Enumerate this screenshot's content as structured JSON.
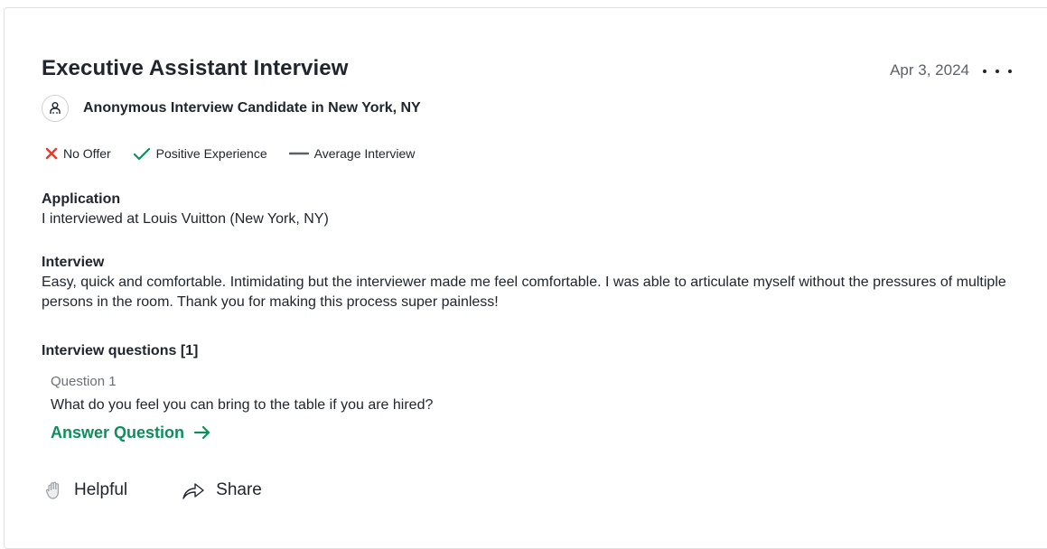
{
  "review": {
    "title": "Executive Assistant Interview",
    "date": "Apr 3, 2024",
    "author": "Anonymous Interview Candidate in New York, NY",
    "badges": [
      {
        "label": "No Offer",
        "icon": "x-icon",
        "color": "#e53e2e"
      },
      {
        "label": "Positive Experience",
        "icon": "checkmark-icon",
        "color": "#0c8f5a"
      },
      {
        "label": "Average Interview",
        "icon": "dash-icon",
        "color": "#5c6168"
      }
    ],
    "application": {
      "label": "Application",
      "text": "I interviewed at Louis Vuitton (New York, NY)"
    },
    "interview": {
      "label": "Interview",
      "text": "Easy, quick and comfortable. Intimidating but the interviewer made me feel comfortable. I was able to articulate myself without the pressures of multiple persons in the room. Thank you for making this process super painless!"
    },
    "questions": {
      "label": "Interview questions [1]",
      "items": [
        {
          "number": "Question 1",
          "text": "What do you feel you can bring to the table if you are hired?"
        }
      ],
      "answer_label": "Answer Question"
    },
    "actions": {
      "helpful_label": "Helpful",
      "share_label": "Share"
    }
  },
  "colors": {
    "accent": "#0c8f5a",
    "negative": "#e53e2e",
    "text": "#20262e",
    "muted": "#5c6168"
  }
}
